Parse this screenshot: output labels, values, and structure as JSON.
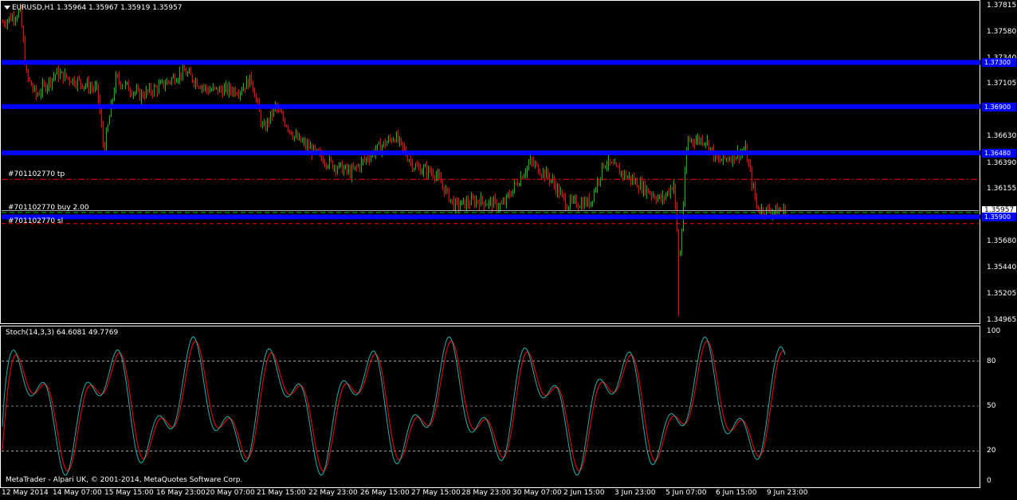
{
  "main": {
    "header_icon": "triangle-down-icon",
    "header": "EURUSD,H1  1.35964 1.35967 1.35919 1.35957",
    "price_ticks": [
      "1.37815",
      "1.37580",
      "1.37340",
      "1.37105",
      "1.36870",
      "1.36630",
      "1.36390",
      "1.36155",
      "1.35957",
      "1.35680",
      "1.35440",
      "1.35205",
      "1.34965"
    ],
    "current_price": "1.35957",
    "horizontal_lines": [
      {
        "price": 1.373,
        "label": "1.37300",
        "color": "#0000ff"
      },
      {
        "price": 1.369,
        "label": "1.36900",
        "color": "#0000ff"
      },
      {
        "price": 1.3648,
        "label": "1.36480",
        "color": "#0000ff"
      },
      {
        "price": 1.359,
        "label": "1.35900",
        "color": "#0000ff"
      }
    ],
    "orders": {
      "tp": {
        "label": "#701102770 tp",
        "price": 1.3624
      },
      "buy": {
        "label": "#701102770 buy 2.00",
        "price": 1.3594
      },
      "sl": {
        "label": "#701102770 sl",
        "price": 1.3584
      }
    },
    "copyright": "MetaTrader - Alpari UK, © 2001-2014, MetaQuotes Software Corp."
  },
  "stoch": {
    "header": "Stoch(14,3,3) 64.6081 49.7769",
    "levels": [
      "100",
      "80",
      "50",
      "20",
      "0"
    ]
  },
  "time_axis": [
    "12 May 2014",
    "14 May 07:00",
    "15 May 15:00",
    "16 May 23:00",
    "20 May 07:00",
    "21 May 15:00",
    "22 May 23:00",
    "26 May 15:00",
    "27 May 15:00",
    "28 May 23:00",
    "30 May 07:00",
    "2 Jun 15:00",
    "3 Jun 23:00",
    "5 Jun 07:00",
    "6 Jun 15:00",
    "9 Jun 23:00"
  ],
  "colors": {
    "background": "#000000",
    "up_candle": "#00c000",
    "down_candle": "#ff0000",
    "support_line": "#0000ff",
    "order_line": "#ff0000",
    "buy_line": "#00c000",
    "stoch_main": "#20b2aa",
    "stoch_signal": "#ff0000",
    "grid": "#ffffff"
  }
}
